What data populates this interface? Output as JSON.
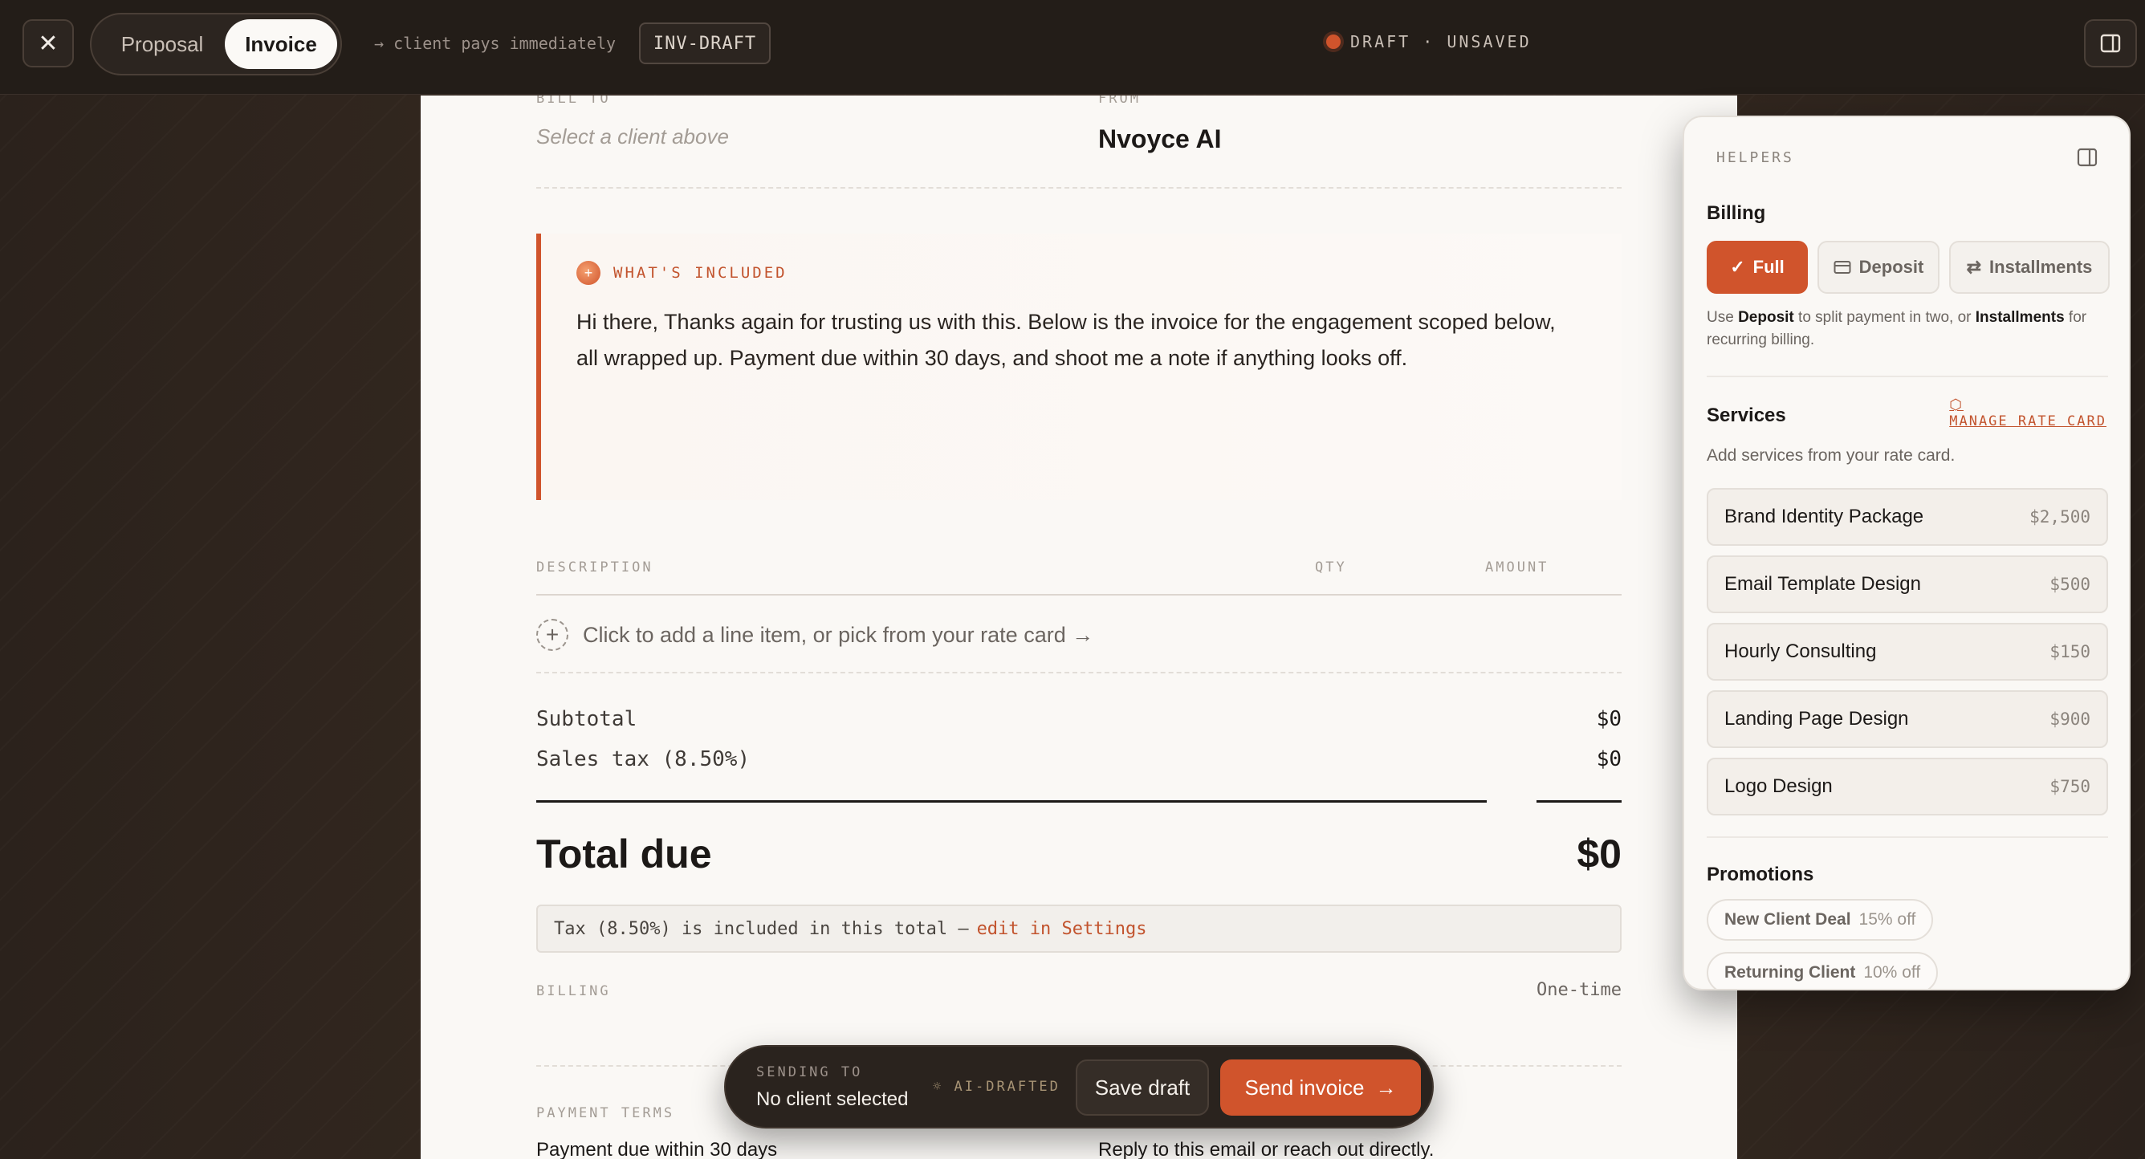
{
  "topbar": {
    "close_icon": "close-icon",
    "tabs": [
      "Proposal",
      "Invoice"
    ],
    "active_tab": "Invoice",
    "pay_note": "→ client pays immediately",
    "invoice_id": "INV-DRAFT",
    "status": "DRAFT · UNSAVED",
    "status_color": "#d0542c"
  },
  "doc": {
    "bill_to_label": "BILL TO",
    "bill_to_value": "Select a client above",
    "from_label": "FROM",
    "from_value": "Nvoyce AI",
    "included_title": "WHAT'S INCLUDED",
    "included_body": "Hi there, Thanks again for trusting us with this. Below is the invoice for the engagement scoped below, all wrapped up. Payment due within 30 days, and shoot me a note if anything looks off.",
    "columns": {
      "description": "DESCRIPTION",
      "qty": "QTY",
      "amount": "AMOUNT"
    },
    "add_line": "Click to add a line item, or pick from your rate card →",
    "subtotal_label": "Subtotal",
    "subtotal_value": "$0",
    "tax_label": "Sales tax (8.50%)",
    "tax_value": "$0",
    "total_label": "Total due",
    "total_value": "$0",
    "tax_note": "Tax (8.50%) is included in this total —",
    "tax_note_link": "edit in Settings",
    "billing_label": "BILLING",
    "billing_value": "One-time",
    "terms_label": "PAYMENT TERMS",
    "terms_value": "Payment due within 30 days",
    "reply_value": "Reply to this email or reach out directly."
  },
  "helpers": {
    "title": "HELPERS",
    "billing_heading": "Billing",
    "billing_options": [
      "Full",
      "Deposit",
      "Installments"
    ],
    "billing_selected": "Full",
    "billing_help_pre": "Use ",
    "billing_help_deposit": "Deposit",
    "billing_help_mid": " to split payment in two, or ",
    "billing_help_install": "Installments",
    "billing_help_post": " for recurring billing.",
    "services_heading": "Services",
    "manage_rate_card": "MANAGE RATE CARD",
    "services_sub": "Add services from your rate card.",
    "services": [
      {
        "name": "Brand Identity Package",
        "price": "$2,500"
      },
      {
        "name": "Email Template Design",
        "price": "$500"
      },
      {
        "name": "Hourly Consulting",
        "price": "$150"
      },
      {
        "name": "Landing Page Design",
        "price": "$900"
      },
      {
        "name": "Logo Design",
        "price": "$750"
      }
    ],
    "promotions_heading": "Promotions",
    "promotions": [
      {
        "name": "New Client Deal",
        "discount": "15% off"
      },
      {
        "name": "Returning Client",
        "discount": "10% off"
      }
    ]
  },
  "sendbar": {
    "sending_to_label": "SENDING TO",
    "sending_to_value": "No client selected",
    "ai_label": "AI-DRAFTED",
    "save_label": "Save draft",
    "send_label": "Send invoice"
  }
}
